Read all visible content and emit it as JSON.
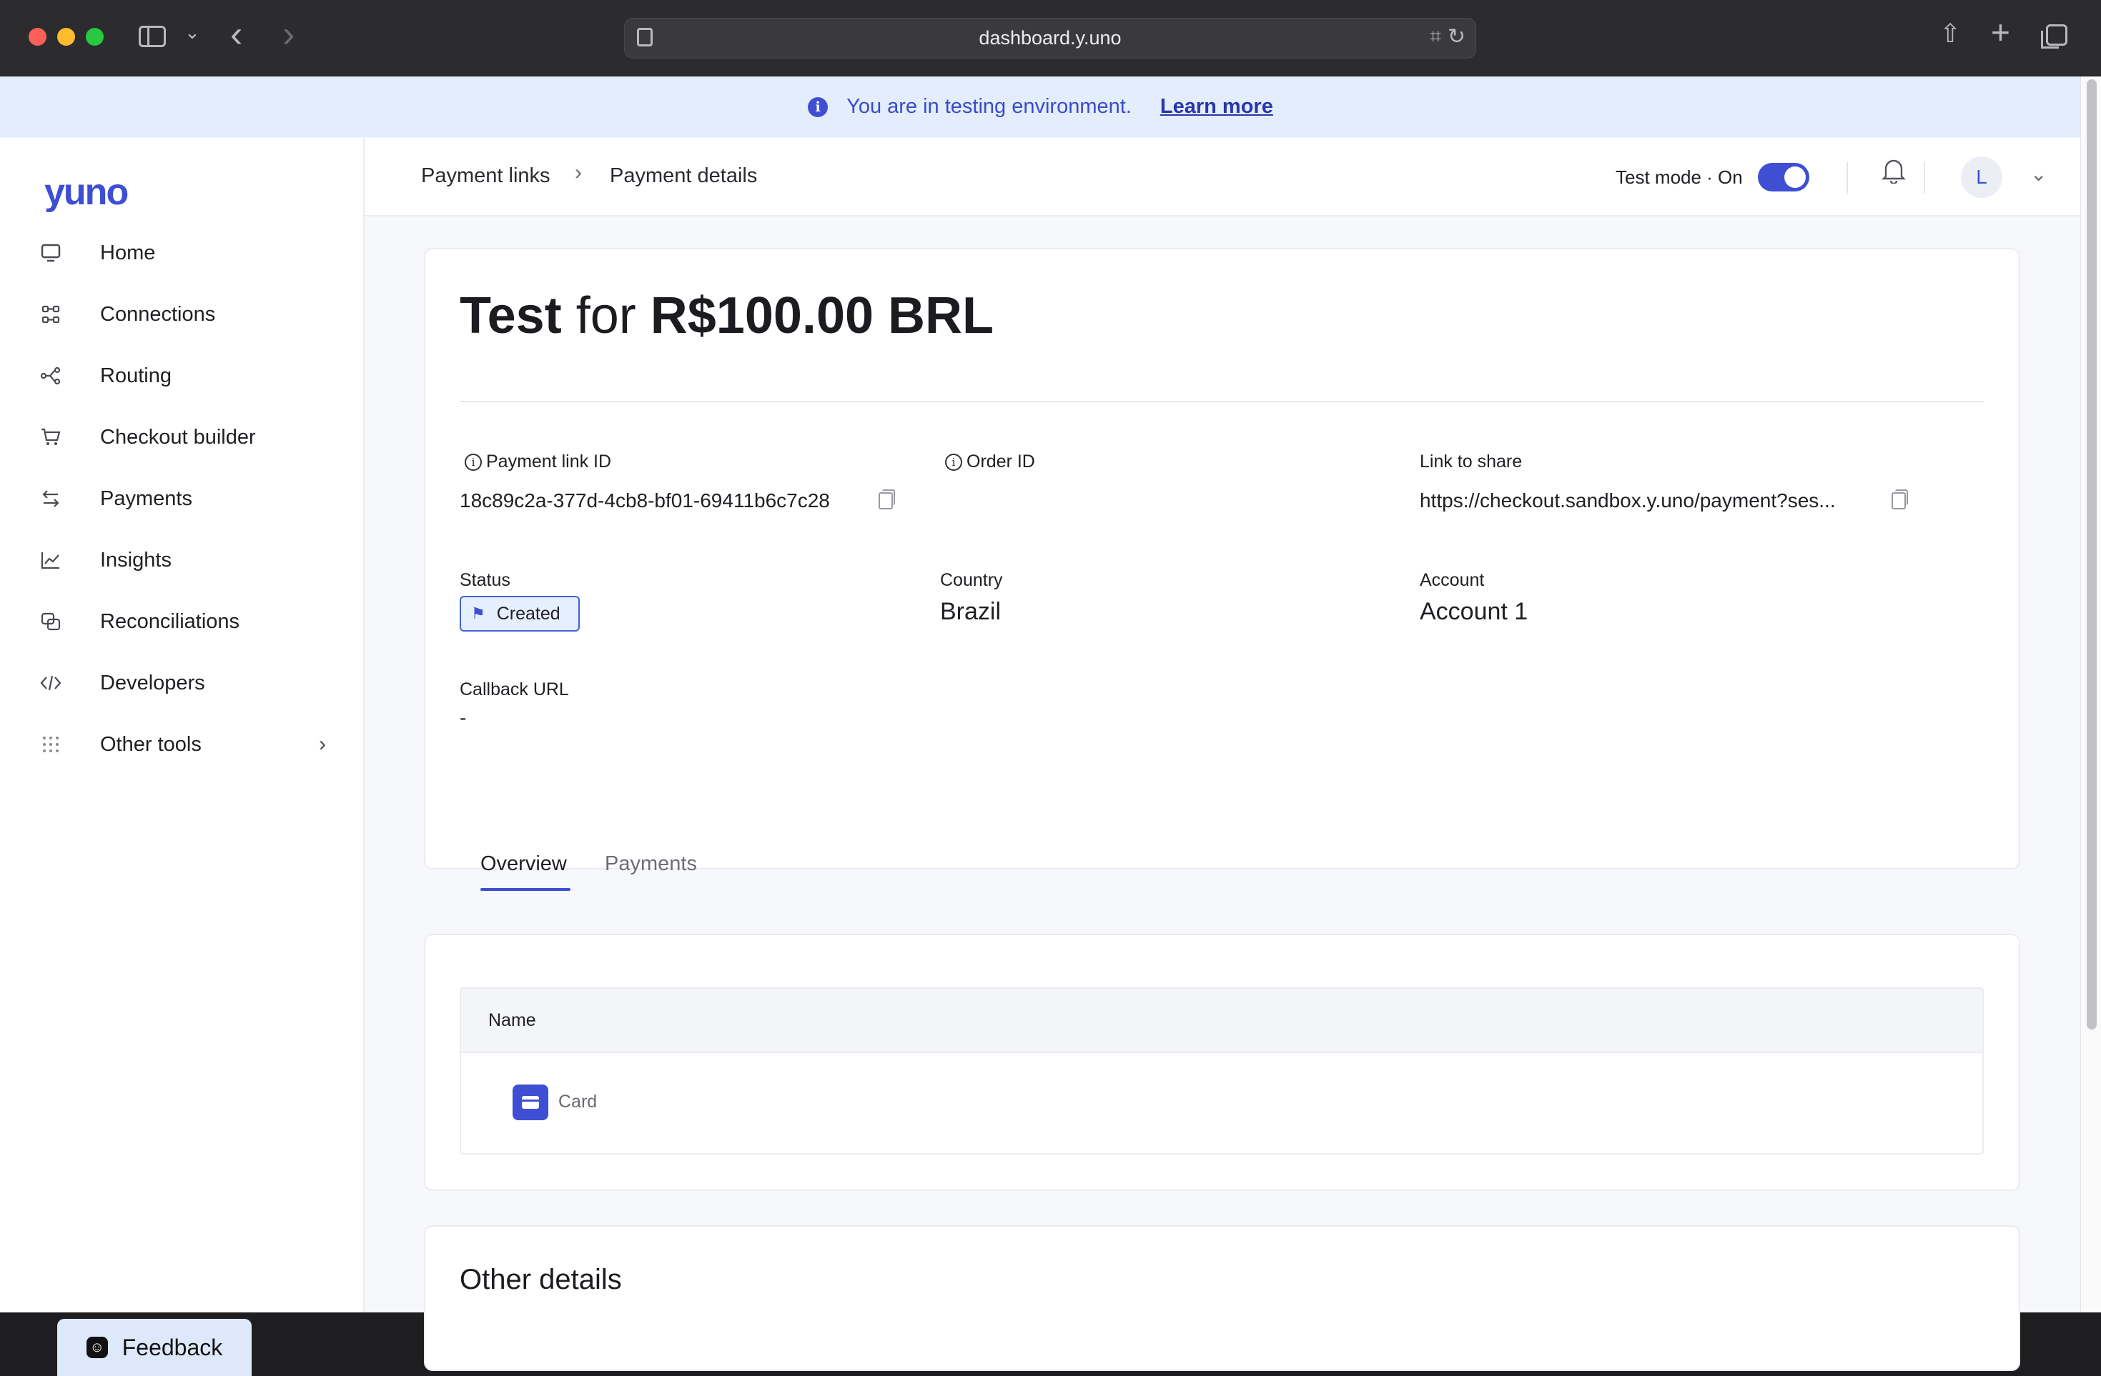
{
  "browser": {
    "url": "dashboard.y.uno"
  },
  "banner": {
    "text": "You are in testing environment.",
    "link": "Learn more"
  },
  "sidebar": {
    "logo": "yuno",
    "items": [
      {
        "label": "Home",
        "icon": "monitor-icon"
      },
      {
        "label": "Connections",
        "icon": "connections-icon"
      },
      {
        "label": "Routing",
        "icon": "routing-icon"
      },
      {
        "label": "Checkout builder",
        "icon": "cart-icon"
      },
      {
        "label": "Payments",
        "icon": "arrows-icon"
      },
      {
        "label": "Insights",
        "icon": "chart-icon"
      },
      {
        "label": "Reconciliations",
        "icon": "reconcile-icon"
      },
      {
        "label": "Developers",
        "icon": "code-icon"
      },
      {
        "label": "Other tools",
        "icon": "grid-icon"
      }
    ],
    "feedback": "Feedback"
  },
  "header": {
    "breadcrumb": [
      "Payment links",
      "Payment details"
    ],
    "test_mode_label": "Test mode · On",
    "test_mode_on": true,
    "avatar_initial": "L"
  },
  "details": {
    "title_name": "Test",
    "title_for": "for",
    "title_amount": "R$100.00",
    "title_currency": "BRL",
    "fields": {
      "payment_link_id_label": "Payment link ID",
      "payment_link_id": "18c89c2a-377d-4cb8-bf01-69411b6c7c28",
      "order_id_label": "Order ID",
      "order_id": "",
      "link_label": "Link to share",
      "link": "https://checkout.sandbox.y.uno/payment?ses...",
      "status_label": "Status",
      "status": "Created",
      "country_label": "Country",
      "country": "Brazil",
      "account_label": "Account",
      "account": "Account 1",
      "callback_label": "Callback URL",
      "callback": "-"
    }
  },
  "tabs": [
    "Overview",
    "Payments"
  ],
  "methods_table": {
    "header": "Name",
    "rows": [
      "Card"
    ]
  },
  "other_details": {
    "title": "Other details"
  },
  "colors": {
    "accent": "#3e4fd4",
    "banner_bg": "#e3edfc",
    "page_bg": "#f7f8fb"
  }
}
